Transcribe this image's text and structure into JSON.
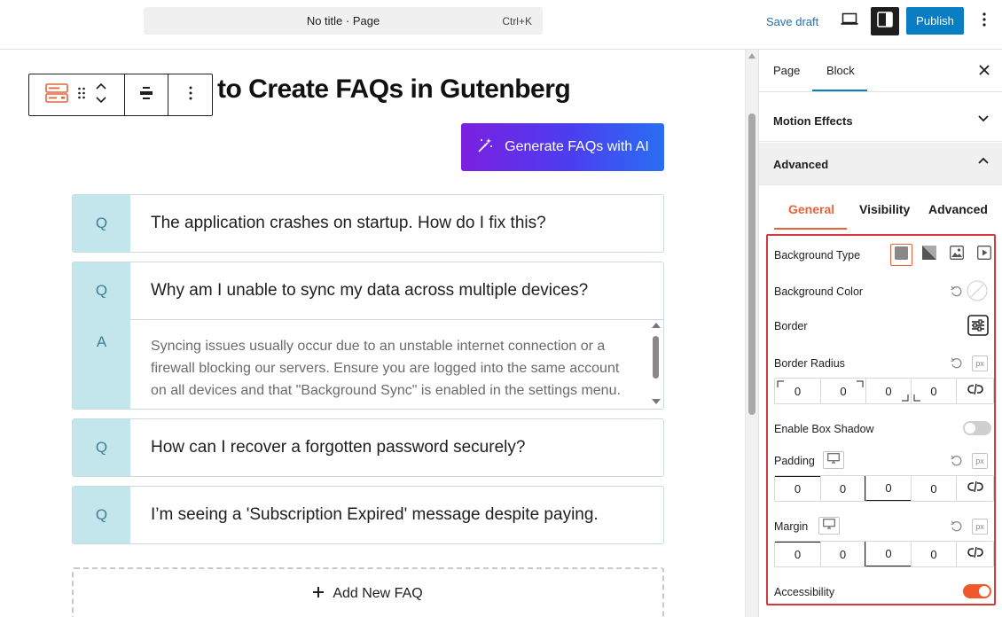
{
  "topbar": {
    "command_title": "No title · Page",
    "command_shortcut": "Ctrl+K",
    "save_draft": "Save draft",
    "publish": "Publish"
  },
  "editor": {
    "heading": "to Create FAQs in Gutenberg",
    "generate_button": "Generate FAQs with AI",
    "faqs": [
      {
        "q_letter": "Q",
        "question": "The application crashes on startup. How do I fix this?"
      },
      {
        "q_letter": "Q",
        "question": "Why am I unable to sync my data across multiple devices?",
        "a_letter": "A",
        "answer_lines": [
          "Syncing issues usually occur due to an unstable internet connection or a",
          "firewall blocking our servers. Ensure you are logged into the same account",
          "on all devices and that \"Background Sync\" is enabled in the settings menu."
        ]
      },
      {
        "q_letter": "Q",
        "question": "How can I recover a forgotten password securely?"
      },
      {
        "q_letter": "Q",
        "question": "I’m seeing a 'Subscription Expired' message despite paying."
      }
    ],
    "add_new_faq": "Add New FAQ"
  },
  "sidebar": {
    "tabs": {
      "page": "Page",
      "block": "Block"
    },
    "sections": {
      "motion_effects": "Motion Effects",
      "advanced": "Advanced"
    },
    "sub_tabs": {
      "general": "General",
      "visibility": "Visibility",
      "advanced": "Advanced"
    },
    "fields": {
      "background_type": "Background Type",
      "background_color": "Background Color",
      "border": "Border",
      "border_radius": "Border Radius",
      "border_radius_values": [
        "0",
        "0",
        "0",
        "0"
      ],
      "enable_box_shadow": "Enable Box Shadow",
      "box_shadow_enabled": false,
      "padding": "Padding",
      "padding_values": [
        "0",
        "0",
        "0",
        "0"
      ],
      "margin": "Margin",
      "margin_values": [
        "0",
        "0",
        "0",
        "0"
      ],
      "accessibility": "Accessibility",
      "accessibility_enabled": true,
      "unit": "px"
    }
  },
  "colors": {
    "accent": "#e7633c",
    "wp_blue": "#0a7ec2",
    "faq_letter_bg": "#c3e6ec",
    "highlight_border": "#d7383d"
  }
}
